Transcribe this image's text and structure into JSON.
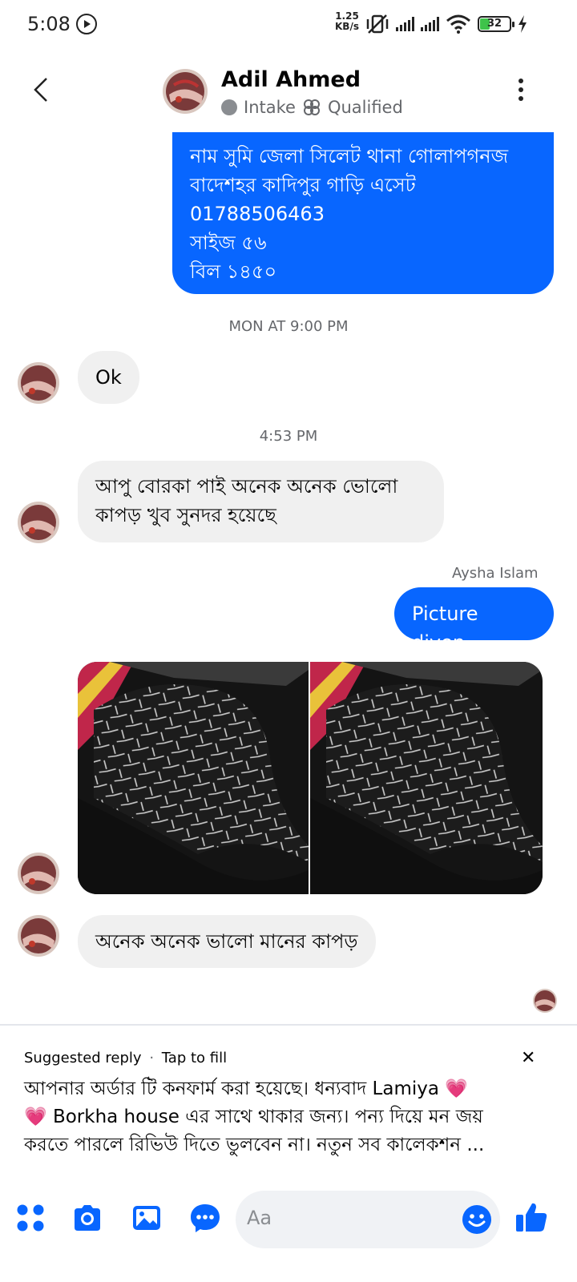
{
  "status_bar": {
    "time": "5:08",
    "speed_value": "1.25",
    "speed_unit": "KB/s",
    "battery": "32"
  },
  "header": {
    "name": "Adil Ahmed",
    "tag_intake": "Intake",
    "tag_qualified": "Qualified"
  },
  "messages": {
    "outgoing_1": [
      "নাম সুমি জেলা সিলেট থানা গোলাপগনজ",
      "বাদেশহর কাদিপুর গাড়ি এসেট",
      "01788506463",
      "সাইজ ৫৬",
      "বিল ১৪৫০"
    ],
    "timestamp_1": "MON AT 9:00 PM",
    "incoming_ok": "Ok",
    "timestamp_2": "4:53 PM",
    "incoming_2": [
      "আপু বোরকা পাই অনেক অনেক ভোলো",
      "কাপড় খুব সুনদর হয়েছে"
    ],
    "sender_name": "Aysha Islam",
    "outgoing_2": "Picture diyen",
    "incoming_3": "অনেক অনেক ভালো মানের কাপড়"
  },
  "suggested_reply": {
    "label": "Suggested reply",
    "separator": "·",
    "action": "Tap to fill",
    "close": "✕",
    "line1": "আপনার অর্ডার টি কনফার্ম করা হয়েছে। ধন্যবাদ Lamiya 💗",
    "line2": "💗 Borkha house এর সাথে থাকার জন্য। পন্য দিয়ে মন জয়",
    "line3": "করতে পারলে রিভিউ দিতে ভুলবেন না। নতুন সব কালেকশন ..."
  },
  "composer": {
    "placeholder": "Aa"
  },
  "colors": {
    "accent": "#0866ff",
    "incoming_bubble": "#f0f0f0",
    "muted_text": "#65676b"
  },
  "icons": [
    "back-chevron-icon",
    "more-vertical-icon",
    "apps-grid-icon",
    "camera-icon",
    "gallery-icon",
    "chat-bubble-icon",
    "emoji-icon",
    "thumbs-up-icon"
  ]
}
